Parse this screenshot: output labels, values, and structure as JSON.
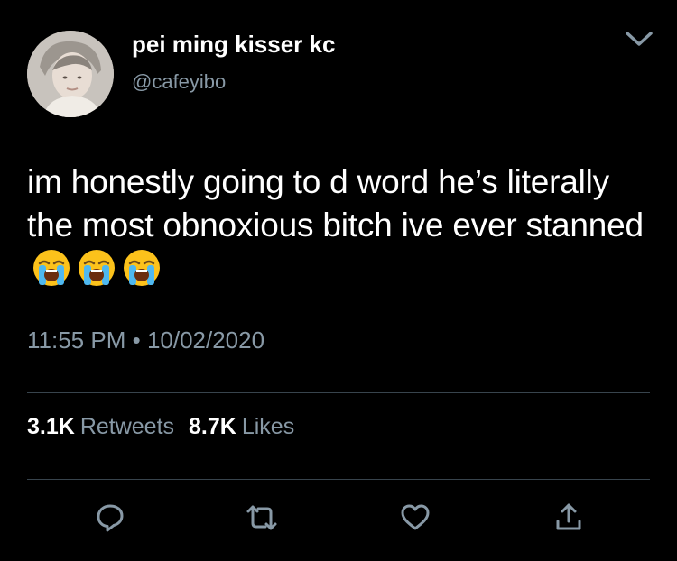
{
  "author": {
    "display_name": "pei ming kisser kc",
    "handle": "@cafeyibo",
    "avatar_icon": "profile-photo"
  },
  "menu_icon": "chevron-down-icon",
  "tweet": {
    "text": "im honestly going to d word he’s literally the most obnoxious bitch ive ever stanned",
    "emojis": [
      "loudly-crying-face",
      "loudly-crying-face",
      "loudly-crying-face"
    ],
    "time": "11:55 PM",
    "separator": "•",
    "date": "10/02/2020"
  },
  "stats": {
    "retweets_count": "3.1K",
    "retweets_label": "Retweets",
    "likes_count": "8.7K",
    "likes_label": "Likes"
  },
  "actions": [
    "reply-icon",
    "retweet-icon",
    "like-icon",
    "share-icon"
  ],
  "colors": {
    "background": "#000000",
    "text_primary": "#ffffff",
    "text_secondary": "#8899a6",
    "divider": "#38444d"
  }
}
